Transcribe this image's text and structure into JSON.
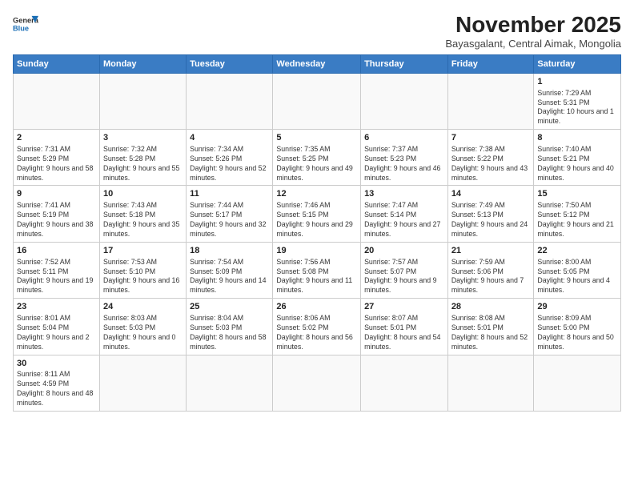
{
  "header": {
    "logo_general": "General",
    "logo_blue": "Blue",
    "month_title": "November 2025",
    "subtitle": "Bayasgalant, Central Aimak, Mongolia"
  },
  "weekdays": [
    "Sunday",
    "Monday",
    "Tuesday",
    "Wednesday",
    "Thursday",
    "Friday",
    "Saturday"
  ],
  "weeks": [
    [
      {
        "day": "",
        "info": ""
      },
      {
        "day": "",
        "info": ""
      },
      {
        "day": "",
        "info": ""
      },
      {
        "day": "",
        "info": ""
      },
      {
        "day": "",
        "info": ""
      },
      {
        "day": "",
        "info": ""
      },
      {
        "day": "1",
        "info": "Sunrise: 7:29 AM\nSunset: 5:31 PM\nDaylight: 10 hours and 1 minute."
      }
    ],
    [
      {
        "day": "2",
        "info": "Sunrise: 7:31 AM\nSunset: 5:29 PM\nDaylight: 9 hours and 58 minutes."
      },
      {
        "day": "3",
        "info": "Sunrise: 7:32 AM\nSunset: 5:28 PM\nDaylight: 9 hours and 55 minutes."
      },
      {
        "day": "4",
        "info": "Sunrise: 7:34 AM\nSunset: 5:26 PM\nDaylight: 9 hours and 52 minutes."
      },
      {
        "day": "5",
        "info": "Sunrise: 7:35 AM\nSunset: 5:25 PM\nDaylight: 9 hours and 49 minutes."
      },
      {
        "day": "6",
        "info": "Sunrise: 7:37 AM\nSunset: 5:23 PM\nDaylight: 9 hours and 46 minutes."
      },
      {
        "day": "7",
        "info": "Sunrise: 7:38 AM\nSunset: 5:22 PM\nDaylight: 9 hours and 43 minutes."
      },
      {
        "day": "8",
        "info": "Sunrise: 7:40 AM\nSunset: 5:21 PM\nDaylight: 9 hours and 40 minutes."
      }
    ],
    [
      {
        "day": "9",
        "info": "Sunrise: 7:41 AM\nSunset: 5:19 PM\nDaylight: 9 hours and 38 minutes."
      },
      {
        "day": "10",
        "info": "Sunrise: 7:43 AM\nSunset: 5:18 PM\nDaylight: 9 hours and 35 minutes."
      },
      {
        "day": "11",
        "info": "Sunrise: 7:44 AM\nSunset: 5:17 PM\nDaylight: 9 hours and 32 minutes."
      },
      {
        "day": "12",
        "info": "Sunrise: 7:46 AM\nSunset: 5:15 PM\nDaylight: 9 hours and 29 minutes."
      },
      {
        "day": "13",
        "info": "Sunrise: 7:47 AM\nSunset: 5:14 PM\nDaylight: 9 hours and 27 minutes."
      },
      {
        "day": "14",
        "info": "Sunrise: 7:49 AM\nSunset: 5:13 PM\nDaylight: 9 hours and 24 minutes."
      },
      {
        "day": "15",
        "info": "Sunrise: 7:50 AM\nSunset: 5:12 PM\nDaylight: 9 hours and 21 minutes."
      }
    ],
    [
      {
        "day": "16",
        "info": "Sunrise: 7:52 AM\nSunset: 5:11 PM\nDaylight: 9 hours and 19 minutes."
      },
      {
        "day": "17",
        "info": "Sunrise: 7:53 AM\nSunset: 5:10 PM\nDaylight: 9 hours and 16 minutes."
      },
      {
        "day": "18",
        "info": "Sunrise: 7:54 AM\nSunset: 5:09 PM\nDaylight: 9 hours and 14 minutes."
      },
      {
        "day": "19",
        "info": "Sunrise: 7:56 AM\nSunset: 5:08 PM\nDaylight: 9 hours and 11 minutes."
      },
      {
        "day": "20",
        "info": "Sunrise: 7:57 AM\nSunset: 5:07 PM\nDaylight: 9 hours and 9 minutes."
      },
      {
        "day": "21",
        "info": "Sunrise: 7:59 AM\nSunset: 5:06 PM\nDaylight: 9 hours and 7 minutes."
      },
      {
        "day": "22",
        "info": "Sunrise: 8:00 AM\nSunset: 5:05 PM\nDaylight: 9 hours and 4 minutes."
      }
    ],
    [
      {
        "day": "23",
        "info": "Sunrise: 8:01 AM\nSunset: 5:04 PM\nDaylight: 9 hours and 2 minutes."
      },
      {
        "day": "24",
        "info": "Sunrise: 8:03 AM\nSunset: 5:03 PM\nDaylight: 9 hours and 0 minutes."
      },
      {
        "day": "25",
        "info": "Sunrise: 8:04 AM\nSunset: 5:03 PM\nDaylight: 8 hours and 58 minutes."
      },
      {
        "day": "26",
        "info": "Sunrise: 8:06 AM\nSunset: 5:02 PM\nDaylight: 8 hours and 56 minutes."
      },
      {
        "day": "27",
        "info": "Sunrise: 8:07 AM\nSunset: 5:01 PM\nDaylight: 8 hours and 54 minutes."
      },
      {
        "day": "28",
        "info": "Sunrise: 8:08 AM\nSunset: 5:01 PM\nDaylight: 8 hours and 52 minutes."
      },
      {
        "day": "29",
        "info": "Sunrise: 8:09 AM\nSunset: 5:00 PM\nDaylight: 8 hours and 50 minutes."
      }
    ],
    [
      {
        "day": "30",
        "info": "Sunrise: 8:11 AM\nSunset: 4:59 PM\nDaylight: 8 hours and 48 minutes."
      },
      {
        "day": "",
        "info": ""
      },
      {
        "day": "",
        "info": ""
      },
      {
        "day": "",
        "info": ""
      },
      {
        "day": "",
        "info": ""
      },
      {
        "day": "",
        "info": ""
      },
      {
        "day": "",
        "info": ""
      }
    ]
  ]
}
